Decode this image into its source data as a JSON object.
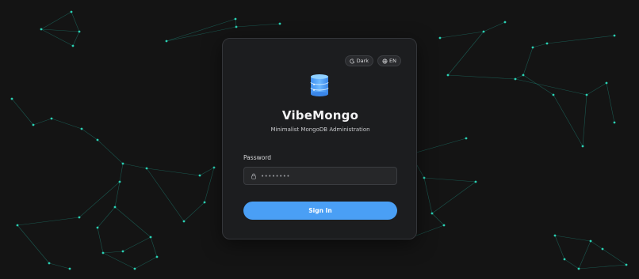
{
  "app": {
    "name": "VibeMongo",
    "tagline": "Minimalist MongoDB Administration"
  },
  "toolbar": {
    "theme_label": "Dark",
    "theme_icon": "moon-icon",
    "language_label": "EN",
    "language_icon": "globe-icon"
  },
  "login": {
    "password_label": "Password",
    "password_value": "••••••••",
    "password_icon": "lock-icon",
    "submit_label": "Sign In"
  },
  "colors": {
    "background": "#141414",
    "card": "#1c1d1f",
    "accent": "#4a9ff5",
    "network": "#2ad1b4"
  }
}
